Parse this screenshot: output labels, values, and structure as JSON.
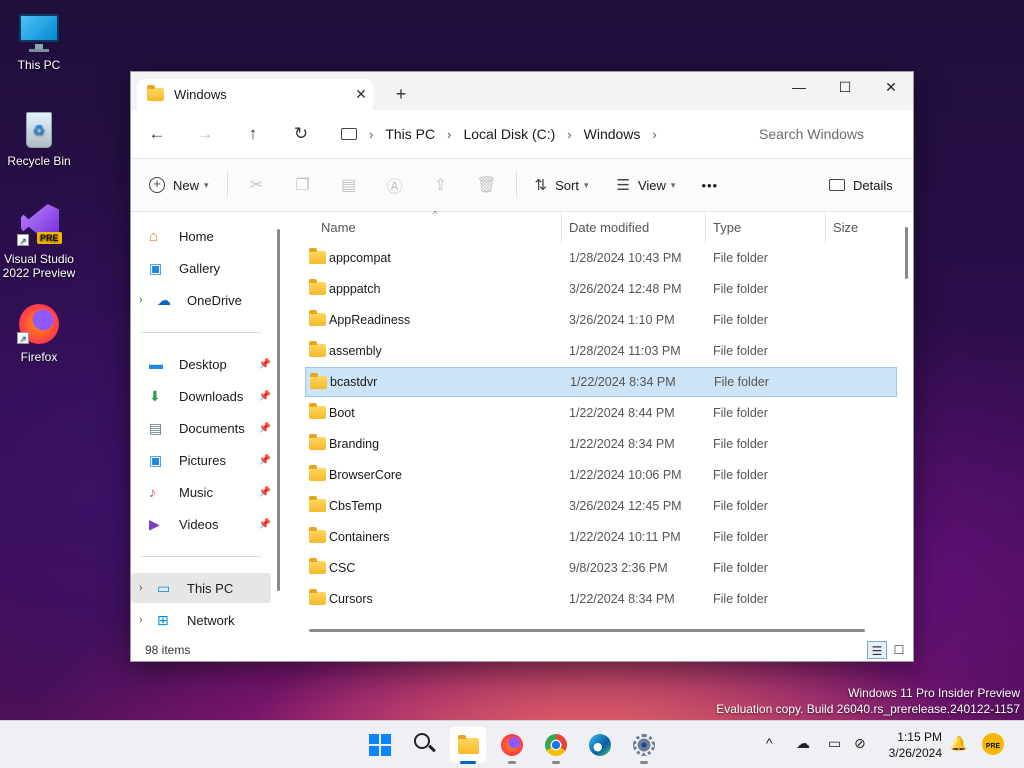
{
  "desktop": {
    "icons": [
      {
        "label": "This PC",
        "icon": "monitor-icon"
      },
      {
        "label": "Recycle Bin",
        "icon": "recycle-bin-icon"
      },
      {
        "label": "Visual Studio 2022 Preview",
        "badge": "PRE",
        "icon": "visual-studio-icon"
      },
      {
        "label": "Firefox",
        "icon": "firefox-icon"
      }
    ],
    "watermark": {
      "line1": "Windows 11 Pro Insider Preview",
      "line2": "Evaluation copy. Build 26040.rs_prerelease.240122-1157"
    }
  },
  "window": {
    "tab_title": "Windows",
    "tab_close": "✕",
    "new_tab": "+",
    "controls": {
      "minimize": "—",
      "maximize": "☐",
      "close": "✕"
    },
    "nav": {
      "back": "←",
      "forward": "→",
      "up": "↑",
      "refresh": "↻"
    },
    "breadcrumb": [
      "This PC",
      "Local Disk (C:)",
      "Windows"
    ],
    "search_placeholder": "Search Windows",
    "toolbar": {
      "new_label": "New",
      "sort_label": "Sort",
      "view_label": "View",
      "more_label": "•••",
      "details_label": "Details"
    },
    "sidebar": {
      "top": [
        {
          "label": "Home",
          "icon": "home-icon"
        },
        {
          "label": "Gallery",
          "icon": "gallery-icon"
        },
        {
          "label": "OneDrive",
          "icon": "onedrive-icon",
          "expandable": true
        }
      ],
      "quick_access": [
        {
          "label": "Desktop",
          "icon": "desktop-icon",
          "pinned": true
        },
        {
          "label": "Downloads",
          "icon": "downloads-icon",
          "pinned": true
        },
        {
          "label": "Documents",
          "icon": "documents-icon",
          "pinned": true
        },
        {
          "label": "Pictures",
          "icon": "pictures-icon",
          "pinned": true
        },
        {
          "label": "Music",
          "icon": "music-icon",
          "pinned": true
        },
        {
          "label": "Videos",
          "icon": "videos-icon",
          "pinned": true
        }
      ],
      "locations": [
        {
          "label": "This PC",
          "icon": "this-pc-icon",
          "expandable": true,
          "selected": true
        },
        {
          "label": "Network",
          "icon": "network-icon",
          "expandable": true
        }
      ]
    },
    "columns": {
      "name": "Name",
      "date": "Date modified",
      "type": "Type",
      "size": "Size"
    },
    "rows": [
      {
        "name": "appcompat",
        "date": "1/28/2024 10:43 PM",
        "type": "File folder"
      },
      {
        "name": "apppatch",
        "date": "3/26/2024 12:48 PM",
        "type": "File folder"
      },
      {
        "name": "AppReadiness",
        "date": "3/26/2024 1:10 PM",
        "type": "File folder"
      },
      {
        "name": "assembly",
        "date": "1/28/2024 11:03 PM",
        "type": "File folder"
      },
      {
        "name": "bcastdvr",
        "date": "1/22/2024 8:34 PM",
        "type": "File folder",
        "selected": true
      },
      {
        "name": "Boot",
        "date": "1/22/2024 8:44 PM",
        "type": "File folder"
      },
      {
        "name": "Branding",
        "date": "1/22/2024 8:34 PM",
        "type": "File folder"
      },
      {
        "name": "BrowserCore",
        "date": "1/22/2024 10:06 PM",
        "type": "File folder"
      },
      {
        "name": "CbsTemp",
        "date": "3/26/2024 12:45 PM",
        "type": "File folder"
      },
      {
        "name": "Containers",
        "date": "1/22/2024 10:11 PM",
        "type": "File folder"
      },
      {
        "name": "CSC",
        "date": "9/8/2023 2:36 PM",
        "type": "File folder"
      },
      {
        "name": "Cursors",
        "date": "1/22/2024 8:34 PM",
        "type": "File folder"
      }
    ],
    "status": "98 items"
  },
  "taskbar": {
    "apps": [
      "start-icon",
      "search-icon",
      "file-explorer-icon",
      "firefox-icon",
      "chrome-icon",
      "edge-icon",
      "settings-icon"
    ],
    "active_app": "file-explorer-icon",
    "tray_icons": [
      "chevron-up-icon",
      "onedrive-offline-icon",
      "display-icon",
      "network-disconnected-icon"
    ],
    "time": "1:15 PM",
    "date": "3/26/2024",
    "pre_badge": "PRE"
  },
  "colors": {
    "selection": "#cce4f7",
    "selection_border": "#99c9ef",
    "accent": "#0067c0",
    "folder": "#f6b92b"
  }
}
